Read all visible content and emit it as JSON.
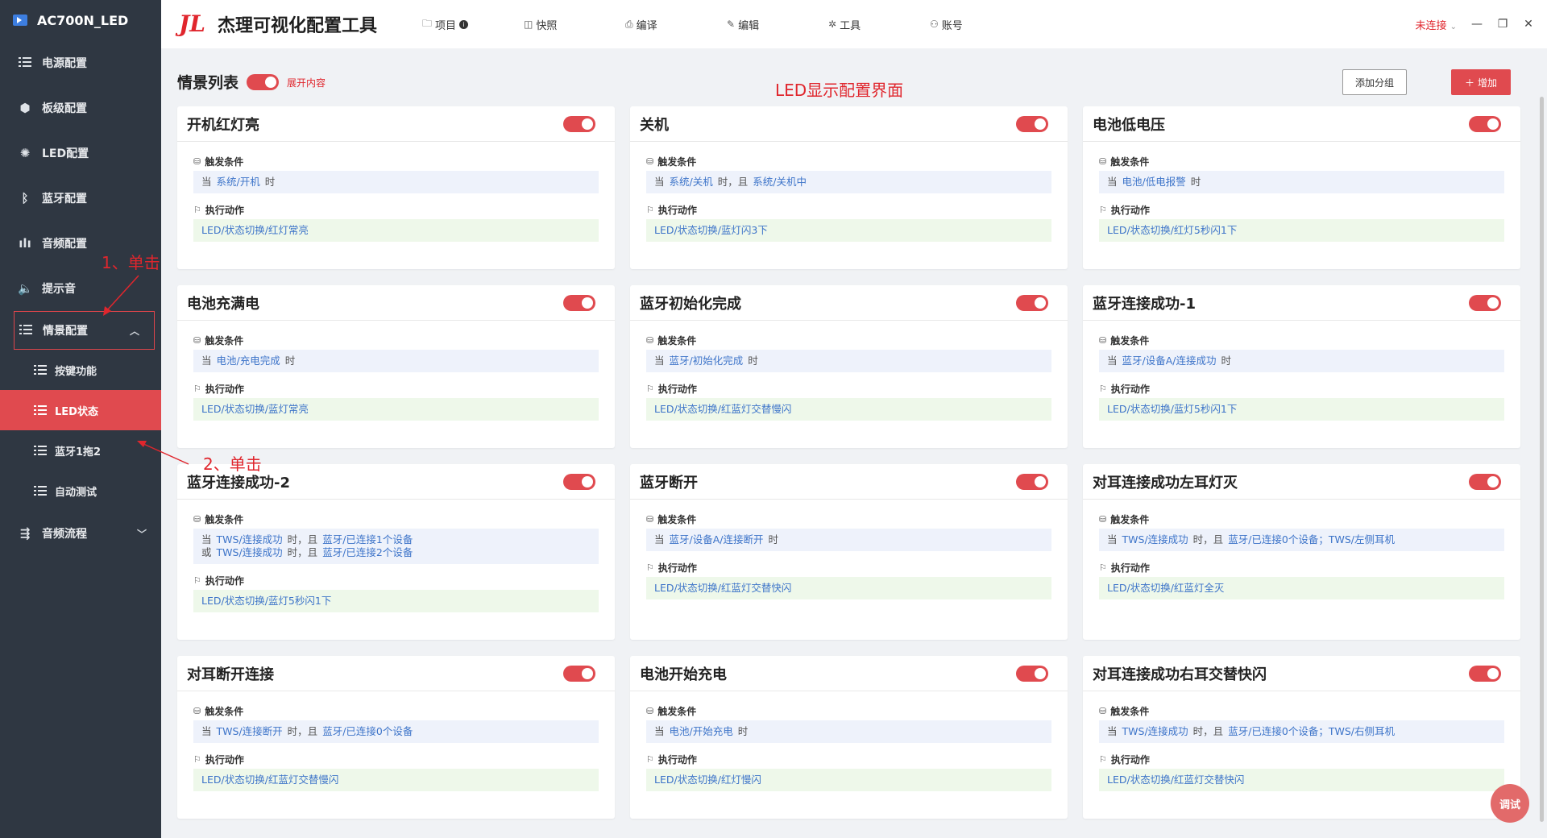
{
  "sidebar": {
    "brand": "AC700N_LED",
    "items": [
      {
        "label": "电源配置",
        "icon": "list-icon"
      },
      {
        "label": "板级配置",
        "icon": "cube-icon"
      },
      {
        "label": "LED配置",
        "icon": "bulb-icon"
      },
      {
        "label": "蓝牙配置",
        "icon": "bluetooth-icon"
      },
      {
        "label": "音频配置",
        "icon": "audio-wave-icon"
      },
      {
        "label": "提示音",
        "icon": "speaker-icon"
      }
    ],
    "open_item": {
      "label": "情景配置",
      "icon": "list-icon"
    },
    "sub_items": [
      {
        "label": "按键功能"
      },
      {
        "label": "LED状态",
        "active": true
      },
      {
        "label": "蓝牙1拖2"
      },
      {
        "label": "自动测试"
      }
    ],
    "last_item": {
      "label": "音频流程",
      "icon": "flow-icon"
    }
  },
  "topbar": {
    "logo_text": "JL",
    "title": "杰理可视化配置工具",
    "menu": [
      {
        "label": "项目",
        "icon": "folder-icon"
      },
      {
        "label": "快照",
        "icon": "camera-icon"
      },
      {
        "label": "编译",
        "icon": "printer-icon"
      },
      {
        "label": "编辑",
        "icon": "pen-icon"
      },
      {
        "label": "工具",
        "icon": "tools-icon"
      },
      {
        "label": "账号",
        "icon": "user-icon"
      }
    ],
    "connection_status": "未连接"
  },
  "main": {
    "title": "情景列表",
    "expand_label": "展开内容",
    "page_caption": "LED显示配置界面",
    "add_group_label": "添加分组",
    "add_label": "增加",
    "trigger_label": "触发条件",
    "action_label": "执行动作",
    "cards": [
      {
        "title": "开机红灯亮",
        "trigger": [
          [
            "当",
            "系统/开机",
            "时"
          ]
        ],
        "action": "LED/状态切换/红灯常亮"
      },
      {
        "title": "关机",
        "trigger": [
          [
            "当",
            "系统/关机",
            "时，且",
            "系统/关机中"
          ]
        ],
        "action": "LED/状态切换/蓝灯闪3下"
      },
      {
        "title": "电池低电压",
        "trigger": [
          [
            "当",
            "电池/低电报警",
            "时"
          ]
        ],
        "action": "LED/状态切换/红灯5秒闪1下"
      },
      {
        "title": "电池充满电",
        "trigger": [
          [
            "当",
            "电池/充电完成",
            "时"
          ]
        ],
        "action": "LED/状态切换/蓝灯常亮"
      },
      {
        "title": "蓝牙初始化完成",
        "trigger": [
          [
            "当",
            "蓝牙/初始化完成",
            "时"
          ]
        ],
        "action": "LED/状态切换/红蓝灯交替慢闪"
      },
      {
        "title": "蓝牙连接成功-1",
        "trigger": [
          [
            "当",
            "蓝牙/设备A/连接成功",
            "时"
          ]
        ],
        "action": "LED/状态切换/蓝灯5秒闪1下"
      },
      {
        "title": "蓝牙连接成功-2",
        "trigger": [
          [
            "当",
            "TWS/连接成功",
            "时，且",
            "蓝牙/已连接1个设备"
          ],
          [
            "或",
            "TWS/连接成功",
            "时，且",
            "蓝牙/已连接2个设备"
          ]
        ],
        "action": "LED/状态切换/蓝灯5秒闪1下"
      },
      {
        "title": "蓝牙断开",
        "trigger": [
          [
            "当",
            "蓝牙/设备A/连接断开",
            "时"
          ]
        ],
        "action": "LED/状态切换/红蓝灯交替快闪"
      },
      {
        "title": "对耳连接成功左耳灯灭",
        "trigger": [
          [
            "当",
            "TWS/连接成功",
            "时，且",
            "蓝牙/已连接0个设备；TWS/左侧耳机"
          ]
        ],
        "action": "LED/状态切换/红蓝灯全灭"
      },
      {
        "title": "对耳断开连接",
        "trigger": [
          [
            "当",
            "TWS/连接断开",
            "时，且",
            "蓝牙/已连接0个设备"
          ]
        ],
        "action": "LED/状态切换/红蓝灯交替慢闪"
      },
      {
        "title": "电池开始充电",
        "trigger": [
          [
            "当",
            "电池/开始充电",
            "时"
          ]
        ],
        "action": "LED/状态切换/红灯慢闪"
      },
      {
        "title": "对耳连接成功右耳交替快闪",
        "trigger": [
          [
            "当",
            "TWS/连接成功",
            "时，且",
            "蓝牙/已连接0个设备；TWS/右侧耳机"
          ]
        ],
        "action": "LED/状态切换/红蓝灯交替快闪"
      }
    ]
  },
  "annotations": {
    "step1": "1、单击",
    "step2": "2、单击",
    "accent_color": "#e0262d"
  },
  "debug_label": "调试"
}
